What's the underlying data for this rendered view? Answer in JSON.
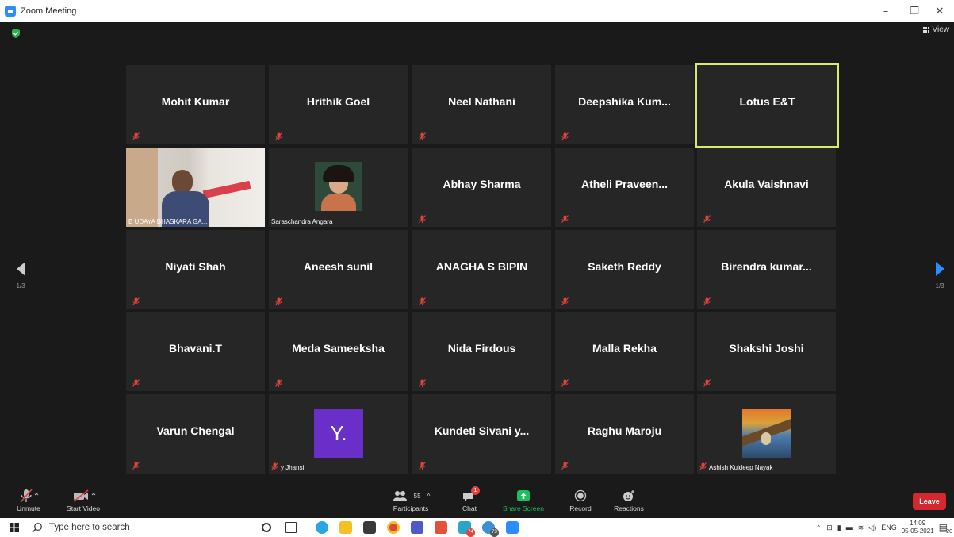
{
  "window": {
    "title": "Zoom Meeting",
    "controls": {
      "minimize": "–",
      "restore": "❐",
      "close": "✕"
    }
  },
  "view_button": {
    "label": "View"
  },
  "gallery": {
    "page_indicator_left": "1/3",
    "page_indicator_right": "1/3",
    "tiles": [
      {
        "name": "Mohit Kumar",
        "muted": true
      },
      {
        "name": "Hrithik Goel",
        "muted": true
      },
      {
        "name": "Neel Nathani",
        "muted": true
      },
      {
        "name": "Deepshika  Kum...",
        "muted": true
      },
      {
        "name": "Lotus E&T",
        "muted": false,
        "active": true
      },
      {
        "caption": "B UDAYA BHASKARA GA...",
        "video": true
      },
      {
        "caption": "Saraschandra Angara",
        "photo": true
      },
      {
        "name": "Abhay Sharma",
        "muted": true
      },
      {
        "name": "Atheli  Praveen...",
        "muted": true
      },
      {
        "name": "Akula Vaishnavi",
        "muted": true
      },
      {
        "name": "Niyati Shah",
        "muted": true
      },
      {
        "name": "Aneesh sunil",
        "muted": true
      },
      {
        "name": "ANAGHA S BIPIN",
        "muted": true
      },
      {
        "name": "Saketh Reddy",
        "muted": true
      },
      {
        "name": "Birendra  kumar...",
        "muted": true
      },
      {
        "name": "Bhavani.T",
        "muted": true
      },
      {
        "name": "Meda Sameeksha",
        "muted": true
      },
      {
        "name": "Nida Firdous",
        "muted": true
      },
      {
        "name": "Malla Rekha",
        "muted": true
      },
      {
        "name": "Shakshi Joshi",
        "muted": true
      },
      {
        "name": "Varun Chengal",
        "muted": true
      },
      {
        "caption": "y Jhansi",
        "letter": "Y.",
        "muted": true
      },
      {
        "name": "Kundeti  Sivani  y...",
        "muted": true
      },
      {
        "name": "Raghu Maroju",
        "muted": true
      },
      {
        "caption": "Ashish Kuldeep Nayak",
        "painting": true,
        "muted": true
      }
    ]
  },
  "toolbar": {
    "unmute": "Unmute",
    "start_video": "Start Video",
    "participants": "Participants",
    "participants_count": "55",
    "chat": "Chat",
    "chat_badge": "1",
    "share_screen": "Share Screen",
    "record": "Record",
    "reactions": "Reactions",
    "leave": "Leave"
  },
  "taskbar": {
    "search_placeholder": "Type here to search",
    "language": "ENG",
    "time": "14:09",
    "date": "05-05-2021",
    "notification_count": "20",
    "badge_74": "74",
    "badge_73": "73"
  },
  "colors": {
    "accent": "#2d8cff",
    "active_speaker": "#d7ec6b",
    "leave": "#d3282d",
    "share_green": "#1bbf5c",
    "mute_red": "#e0443e"
  }
}
